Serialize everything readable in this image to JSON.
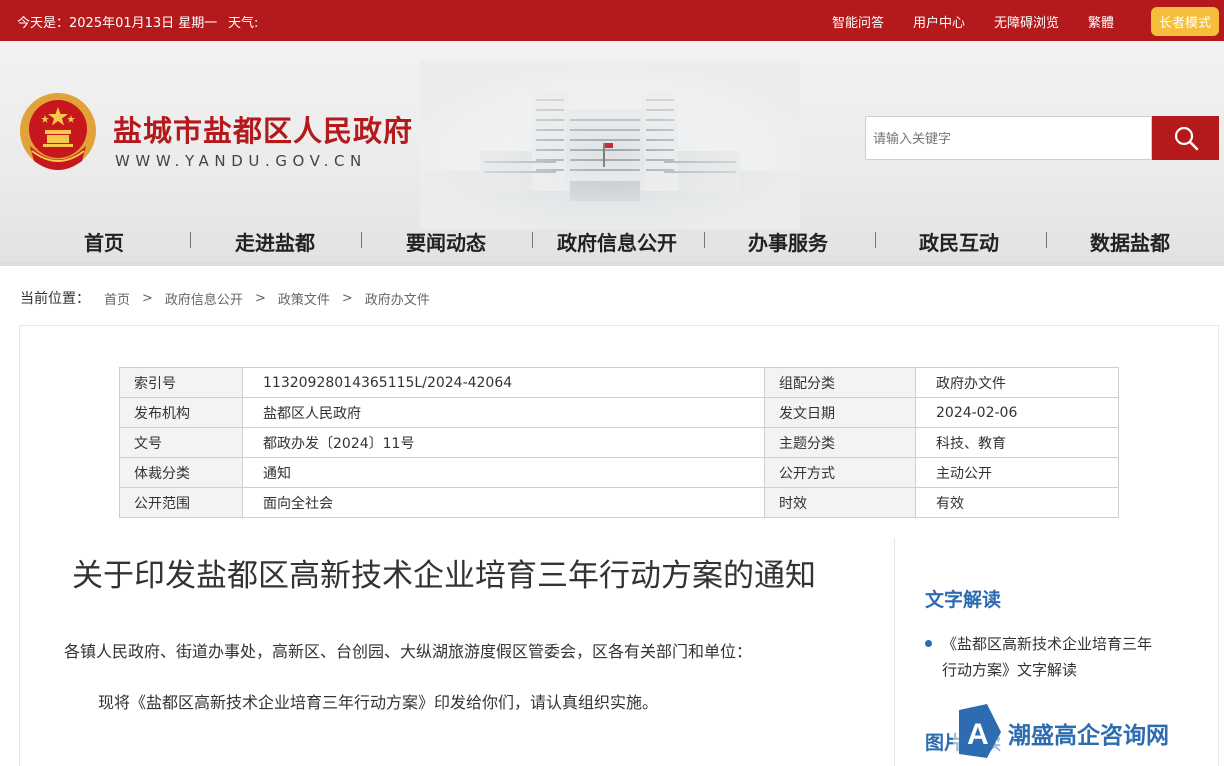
{
  "topbar": {
    "date": "今天是：2025年01月13日 星期一",
    "weather": "天气:",
    "links": [
      "智能问答",
      "用户中心",
      "无障碍浏览",
      "繁體"
    ],
    "elder_mode": "长者模式"
  },
  "header": {
    "site_title": "盐城市盐都区人民政府",
    "site_url": "WWW.YANDU.GOV.CN",
    "search_placeholder": "请输入关键字"
  },
  "nav": [
    "首页",
    "走进盐都",
    "要闻动态",
    "政府信息公开",
    "办事服务",
    "政民互动",
    "数据盐都"
  ],
  "breadcrumb": {
    "label": "当前位置：",
    "items": [
      "首页",
      "政府信息公开",
      "政策文件",
      "政府办文件"
    ],
    "separator": ">"
  },
  "meta": {
    "rows": [
      [
        "索引号",
        "11320928014365115L/2024-42064",
        "组配分类",
        "政府办文件"
      ],
      [
        "发布机构",
        "盐都区人民政府",
        "发文日期",
        "2024-02-06"
      ],
      [
        "文号",
        "都政办发〔2024〕11号",
        "主题分类",
        "科技、教育"
      ],
      [
        "体裁分类",
        "通知",
        "公开方式",
        "主动公开"
      ],
      [
        "公开范围",
        "面向全社会",
        "时效",
        "有效"
      ]
    ]
  },
  "article": {
    "title": "关于印发盐都区高新技术企业培育三年行动方案的通知",
    "para1": "各镇人民政府、街道办事处，高新区、台创园、大纵湖旅游度假区管委会，区各有关部门和单位：",
    "para2": "现将《盐都区高新技术企业培育三年行动方案》印发给你们，请认真组织实施。"
  },
  "sidebar": {
    "heading": "文字解读",
    "link": "《盐都区高新技术企业培育三年行动方案》文字解读",
    "heading2": "图片解读"
  },
  "watermark": {
    "text": "潮盛高企咨询网"
  },
  "colors": {
    "brand_red": "#b4191c",
    "elder_yellow": "#f5bd3b",
    "accent_blue": "#2d6cb0"
  }
}
